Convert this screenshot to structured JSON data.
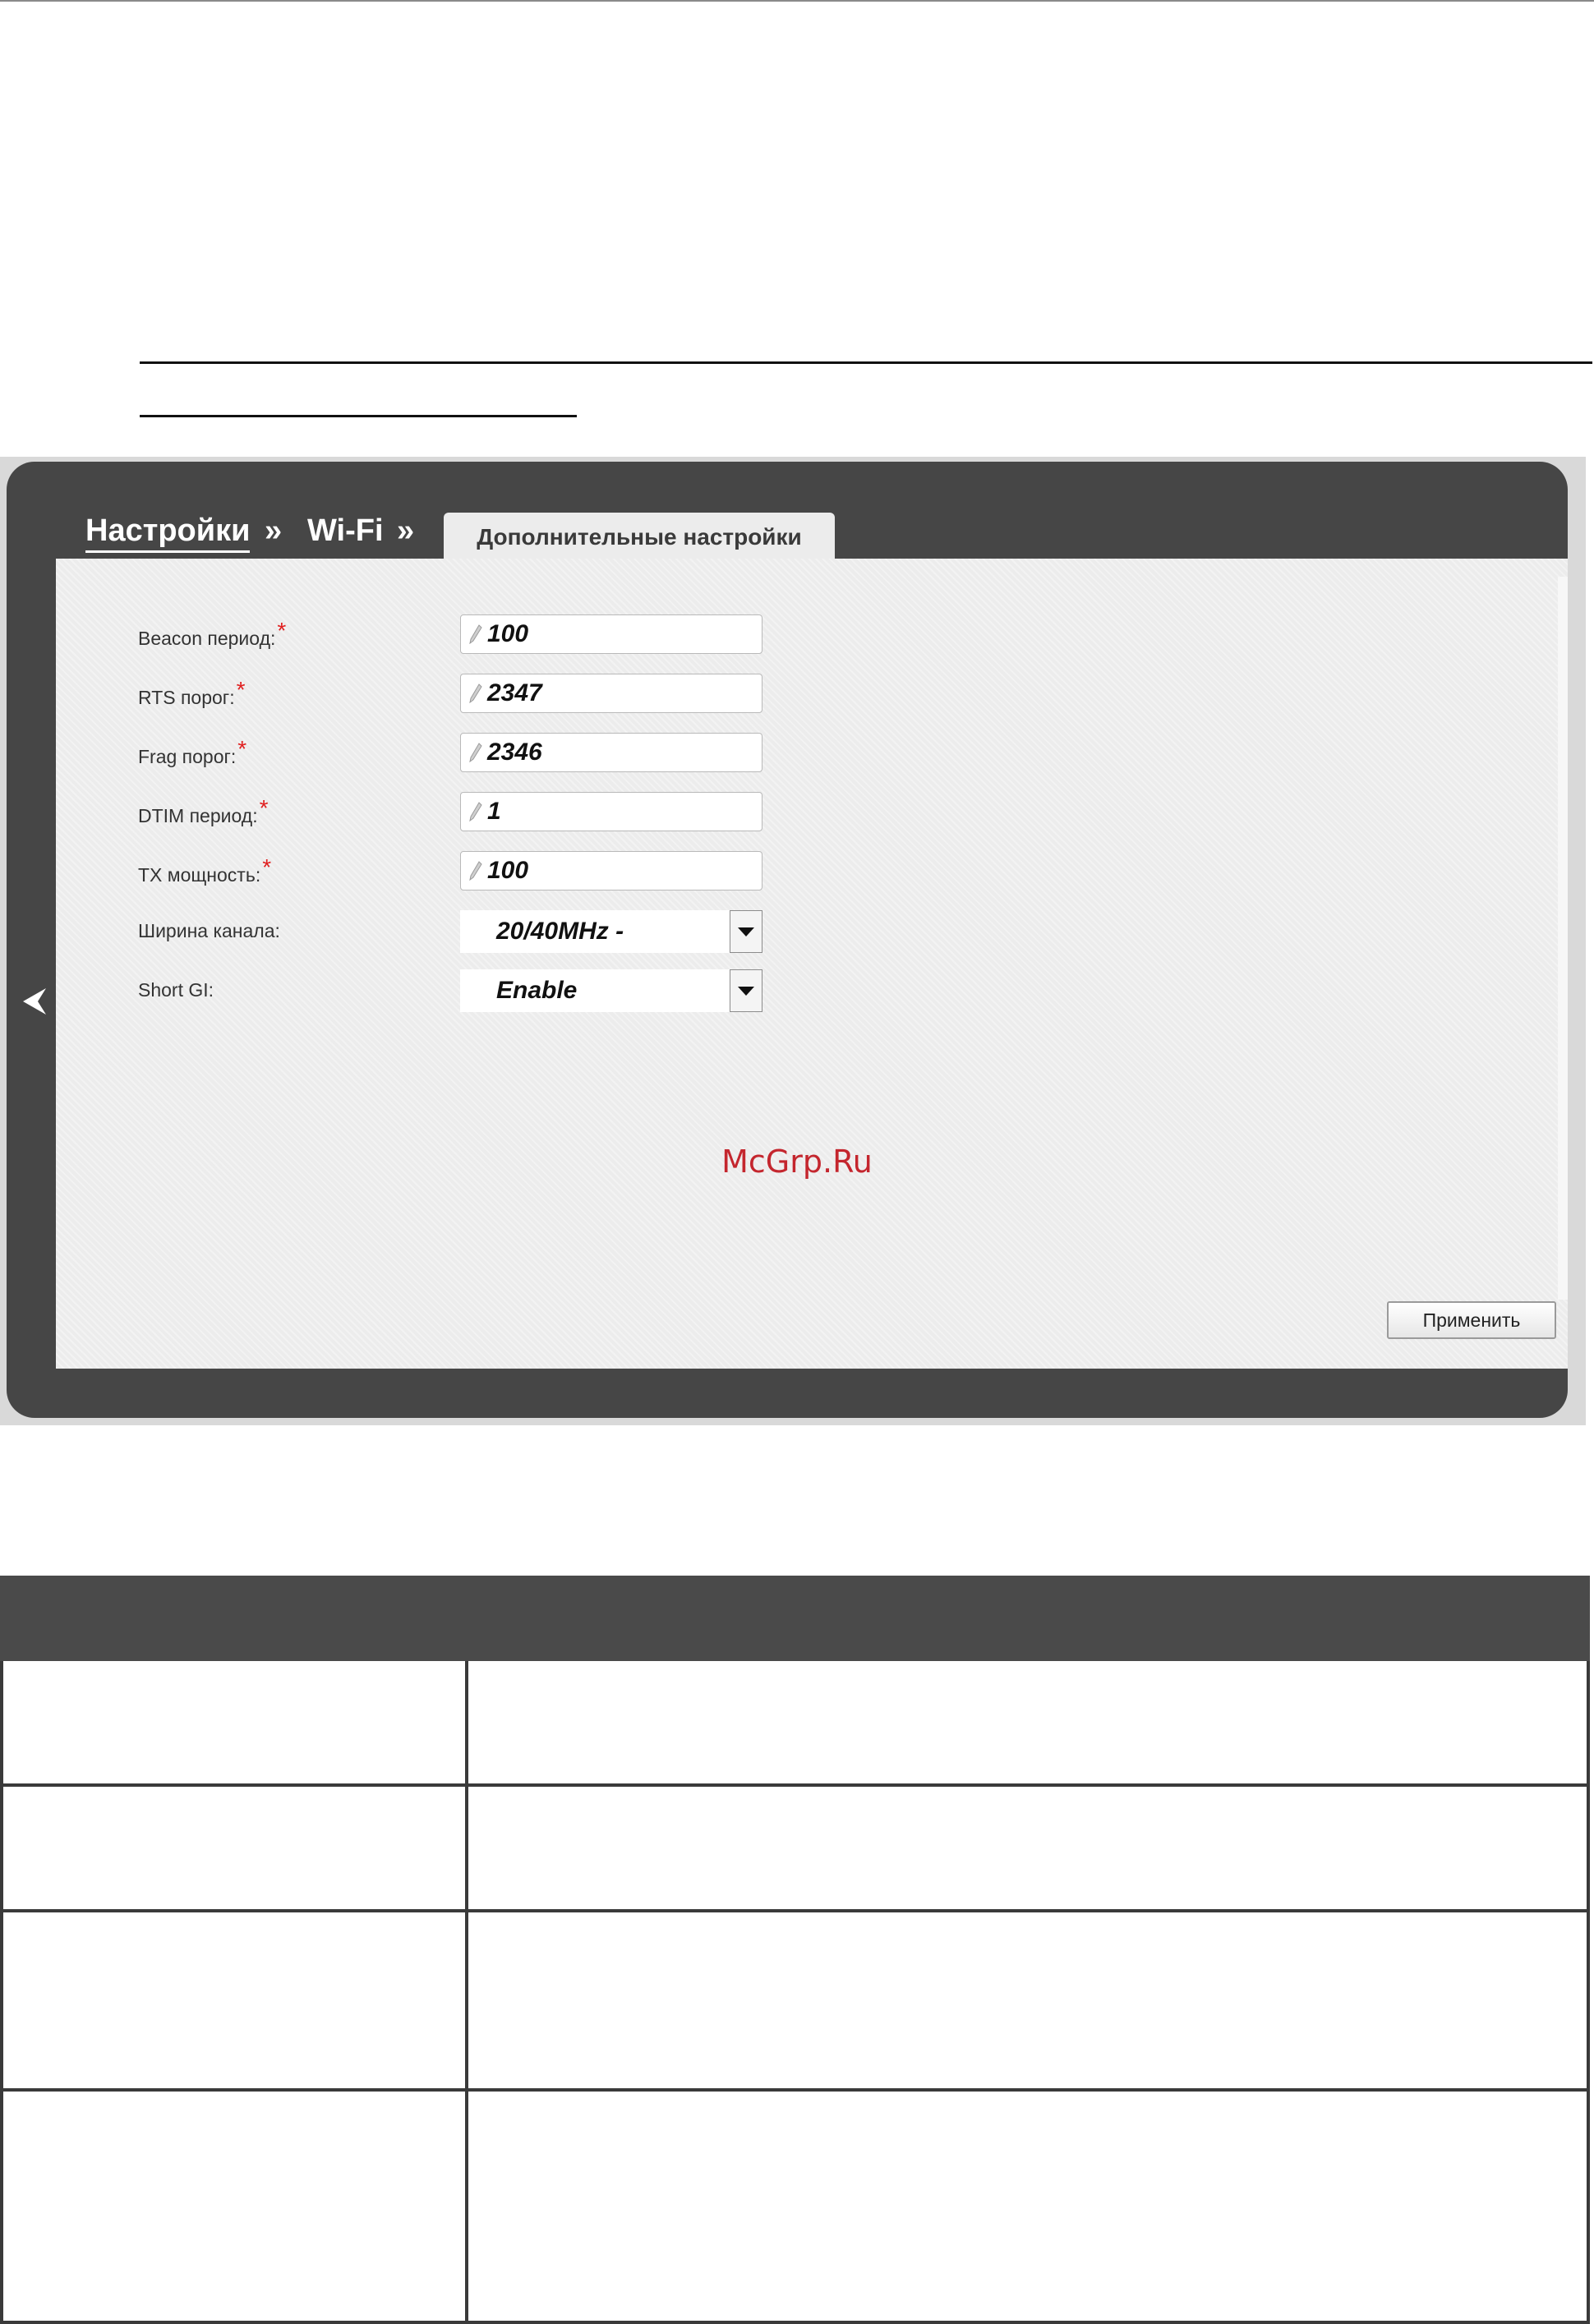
{
  "breadcrumb": {
    "settings": "Настройки",
    "separator1": "»",
    "wifi": "Wi-Fi",
    "separator2": "»"
  },
  "tab": {
    "label": "Дополнительные настройки"
  },
  "form": {
    "required_marker": "*",
    "beacon": {
      "label": "Beacon период:",
      "value": "100"
    },
    "rts": {
      "label": "RTS порог:",
      "value": "2347"
    },
    "frag": {
      "label": "Frag порог:",
      "value": "2346"
    },
    "dtim": {
      "label": "DTIM период:",
      "value": "1"
    },
    "tx": {
      "label": "TX мощность:",
      "value": "100"
    },
    "channel_width": {
      "label": "Ширина канала:",
      "selected": "20/40MHz -"
    },
    "short_gi": {
      "label": "Short GI:",
      "selected": "Enable"
    }
  },
  "apply_button": "Применить",
  "watermark": "McGrp.Ru",
  "colors": {
    "frame": "#464646",
    "panel": "#ececec",
    "required": "#e02020",
    "watermark": "#c4262e",
    "table_header": "#4a4a4a"
  }
}
